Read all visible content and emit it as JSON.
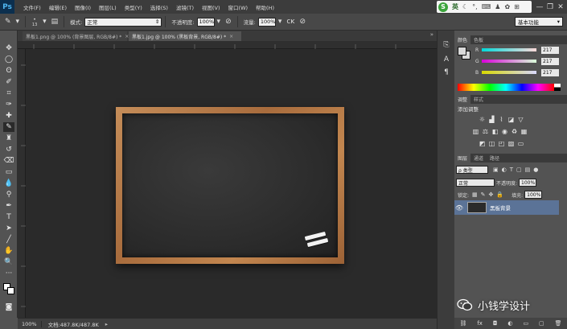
{
  "app": {
    "logo": "Ps"
  },
  "menu": [
    "文件(F)",
    "编辑(E)",
    "图像(I)",
    "图层(L)",
    "类型(Y)",
    "选择(S)",
    "滤镜(T)",
    "视图(V)",
    "窗口(W)",
    "帮助(H)"
  ],
  "ime": {
    "logo": "S",
    "lang": "英"
  },
  "window_controls": {
    "minimize": "—",
    "restore": "❐",
    "close": "✕"
  },
  "options": {
    "brush_size": "13",
    "mode_label": "模式:",
    "mode_value": "正常",
    "opacity_label": "不透明度:",
    "opacity_value": "100%",
    "flow_label": "流量:",
    "flow_value": "100%",
    "workspace": "基本功能"
  },
  "tabs": [
    {
      "label": "黑板1.png @ 100% (背景图层, RGB/8#) *",
      "close": "×"
    },
    {
      "label": "黑板1.jpg @ 100% (黑板背景, RGB/8#) *",
      "close": "×"
    }
  ],
  "status": {
    "zoom": "100%",
    "doc_info": "文档:487.8K/487.8K"
  },
  "color_panel": {
    "tabs": [
      "颜色",
      "色板"
    ],
    "channels": [
      {
        "name": "R",
        "value": "217"
      },
      {
        "name": "G",
        "value": "217"
      },
      {
        "name": "B",
        "value": "217"
      }
    ],
    "foreground": "#d9d9d9",
    "background": "#d9d9d9"
  },
  "adjust_panel": {
    "tabs": [
      "调整",
      "样式"
    ],
    "title": "添加调整"
  },
  "layers_panel": {
    "tabs": [
      "图层",
      "通道",
      "路径"
    ],
    "filter_value": "ρ 类型",
    "blend_mode": "正常",
    "opacity_label": "不透明度:",
    "opacity_value": "100%",
    "lock_label": "锁定:",
    "fill_label": "填充:",
    "fill_value": "100%",
    "layers": [
      {
        "name": "黑板背景",
        "visible": true
      }
    ]
  },
  "watermark": {
    "text": "小钱学设计"
  }
}
